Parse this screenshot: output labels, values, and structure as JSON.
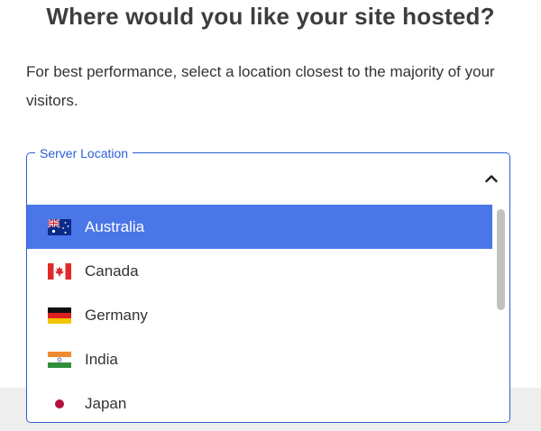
{
  "heading": "Where would you like your site hosted?",
  "description": "For best performance, select a location closest to the majority of your visitors.",
  "field": {
    "label": "Server Location",
    "selected": "",
    "accent": "#2a5fd6"
  },
  "dropdown": {
    "highlight_color": "#4a76e8",
    "options": [
      {
        "label": "Australia",
        "flag": "australia-flag-icon",
        "highlighted": true
      },
      {
        "label": "Canada",
        "flag": "canada-flag-icon",
        "highlighted": false
      },
      {
        "label": "Germany",
        "flag": "germany-flag-icon",
        "highlighted": false
      },
      {
        "label": "India",
        "flag": "india-flag-icon",
        "highlighted": false
      },
      {
        "label": "Japan",
        "flag": "japan-flag-icon",
        "highlighted": false
      }
    ]
  }
}
